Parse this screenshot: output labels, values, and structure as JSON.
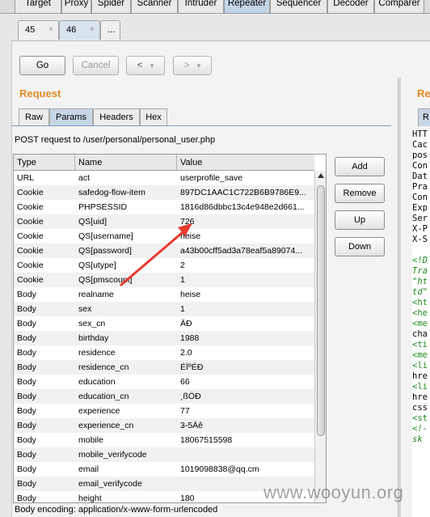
{
  "top_tabs": [
    "Target",
    "Proxy",
    "Spider",
    "Scanner",
    "Intruder",
    "Repeater",
    "Sequencer",
    "Decoder",
    "Comparer"
  ],
  "active_top_tab": "Repeater",
  "sub_tabs": [
    {
      "label": "45",
      "close": "×"
    },
    {
      "label": "46",
      "close": "×"
    },
    {
      "label": "..."
    }
  ],
  "toolbar": {
    "go": "Go",
    "cancel": "Cancel",
    "back": "<",
    "back_drop": "▾",
    "forward": ">",
    "forward_drop": "▾"
  },
  "request": {
    "title": "Request",
    "tabs": [
      "Raw",
      "Params",
      "Headers",
      "Hex"
    ],
    "active_tab": "Params",
    "post_line": "POST request to /user/personal/personal_user.php",
    "columns": [
      "Type",
      "Name",
      "Value"
    ],
    "rows": [
      [
        "URL",
        "act",
        "userprofile_save"
      ],
      [
        "Cookie",
        "safedog-flow-item",
        "897DC1AAC1C722B6B9786E9..."
      ],
      [
        "Cookie",
        "PHPSESSID",
        "1816d86dbbc13c4e948e2d661..."
      ],
      [
        "Cookie",
        "QS[uid]",
        "726"
      ],
      [
        "Cookie",
        "QS[username]",
        "heise"
      ],
      [
        "Cookie",
        "QS[password]",
        "a43b00cff5ad3a78eaf5a89074..."
      ],
      [
        "Cookie",
        "QS[utype]",
        "2"
      ],
      [
        "Cookie",
        "QS[pmscount]",
        "1"
      ],
      [
        "Body",
        "realname",
        "heise"
      ],
      [
        "Body",
        "sex",
        "1"
      ],
      [
        "Body",
        "sex_cn",
        "ÄĐ"
      ],
      [
        "Body",
        "birthday",
        "1988"
      ],
      [
        "Body",
        "residence",
        "2.0"
      ],
      [
        "Body",
        "residence_cn",
        "ÉÏºÉĐ"
      ],
      [
        "Body",
        "education",
        "66"
      ],
      [
        "Body",
        "education_cn",
        "¸ßÖĐ"
      ],
      [
        "Body",
        "experience",
        "77"
      ],
      [
        "Body",
        "experience_cn",
        "3-5Äê"
      ],
      [
        "Body",
        "mobile",
        "18067515598"
      ],
      [
        "Body",
        "mobile_verifycode",
        ""
      ],
      [
        "Body",
        "email",
        "1019098838@qq.cm"
      ],
      [
        "Body",
        "email_verifycode",
        ""
      ],
      [
        "Body",
        "height",
        "180"
      ]
    ],
    "side_buttons": [
      "Add",
      "Remove",
      "Up",
      "Down"
    ],
    "encoding": "Body encoding:  application/x-www-form-urlencoded"
  },
  "response": {
    "title": "Re",
    "tab": "R",
    "lines": [
      {
        "t": "HTT",
        "k": "plain"
      },
      {
        "t": "Cac",
        "k": "plain"
      },
      {
        "t": "pos",
        "k": "plain"
      },
      {
        "t": "Con",
        "k": "plain"
      },
      {
        "t": "Dat",
        "k": "plain"
      },
      {
        "t": "Pra",
        "k": "plain"
      },
      {
        "t": "Con",
        "k": "plain"
      },
      {
        "t": "Exp",
        "k": "plain"
      },
      {
        "t": "Ser",
        "k": "plain"
      },
      {
        "t": "X-P",
        "k": "plain"
      },
      {
        "t": "X-S",
        "k": "plain"
      },
      {
        "t": "",
        "k": "blank"
      },
      {
        "t": "<!D",
        "k": "cmt"
      },
      {
        "t": "Tra",
        "k": "cmt"
      },
      {
        "t": "\"ht",
        "k": "cmt"
      },
      {
        "t": "td\"",
        "k": "cmt"
      },
      {
        "t": "<ht",
        "k": "tag"
      },
      {
        "t": "<he",
        "k": "tag"
      },
      {
        "t": "<me",
        "k": "tag"
      },
      {
        "t": "cha",
        "k": "plain"
      },
      {
        "t": "<ti",
        "k": "tag"
      },
      {
        "t": "<me",
        "k": "tag"
      },
      {
        "t": "<li",
        "k": "tag"
      },
      {
        "t": "hre",
        "k": "plain"
      },
      {
        "t": "<li",
        "k": "tag"
      },
      {
        "t": "hre",
        "k": "plain"
      },
      {
        "t": "css",
        "k": "plain"
      },
      {
        "t": "<st",
        "k": "tag"
      },
      {
        "t": "<!-",
        "k": "cmt"
      },
      {
        "t": "sk",
        "k": "cmt"
      }
    ]
  },
  "watermark": "www.wooyun.org",
  "colors": {
    "section_title": "#e38a24",
    "annotation_arrow": "#e83a2e"
  }
}
